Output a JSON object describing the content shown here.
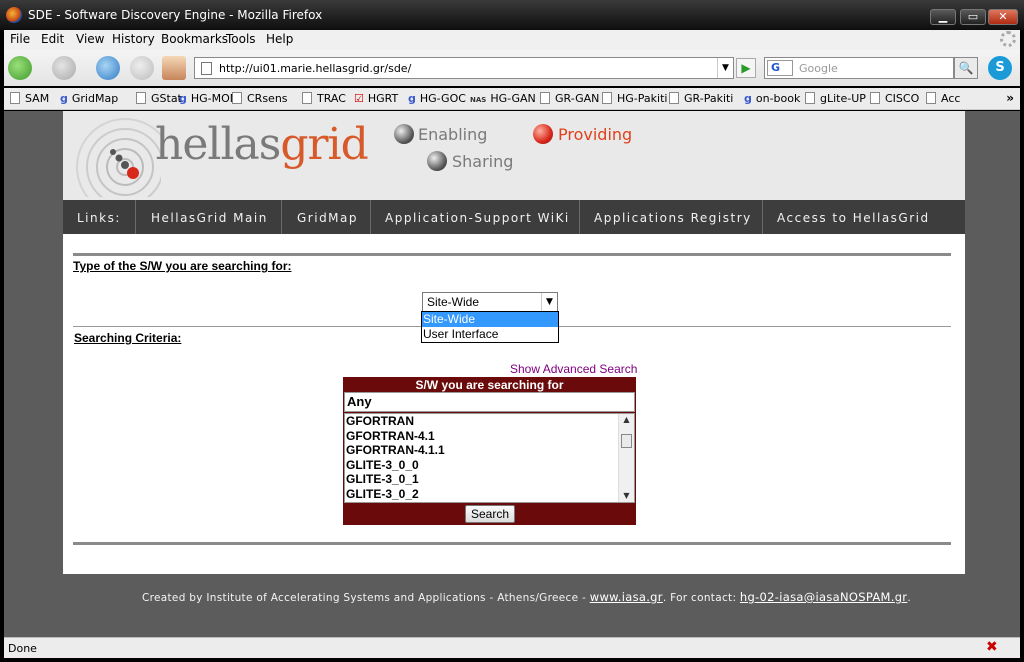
{
  "window": {
    "title": "SDE - Software Discovery Engine - Mozilla Firefox",
    "min_label": "▁",
    "max_label": "▭",
    "close_label": "✕"
  },
  "menu": [
    "File",
    "Edit",
    "View",
    "History",
    "Bookmarks",
    "Tools",
    "Help"
  ],
  "toolbar": {
    "url": "http://ui01.marie.hellasgrid.gr/sde/",
    "search_engine": "G",
    "search_placeholder": "Google",
    "go_icon": "▶",
    "search_icon": "🔍",
    "skype_label": "S"
  },
  "bookmarks": [
    {
      "label": "SAM",
      "icon": "page"
    },
    {
      "label": "GridMap",
      "icon": "g"
    },
    {
      "label": "GStat",
      "icon": "page"
    },
    {
      "label": "HG-MON",
      "icon": "g"
    },
    {
      "label": "CRsens",
      "icon": "page"
    },
    {
      "label": "TRAC",
      "icon": "page"
    },
    {
      "label": "HGRT",
      "icon": "check"
    },
    {
      "label": "HG-GOC",
      "icon": "g"
    },
    {
      "label": "HG-GAN",
      "icon": "nas"
    },
    {
      "label": "GR-GAN",
      "icon": "page"
    },
    {
      "label": "HG-Pakiti",
      "icon": "page"
    },
    {
      "label": "GR-Pakiti",
      "icon": "page"
    },
    {
      "label": "on-book",
      "icon": "g"
    },
    {
      "label": "gLite-UP",
      "icon": "page"
    },
    {
      "label": "CISCO",
      "icon": "page"
    },
    {
      "label": "Acc",
      "icon": "page"
    }
  ],
  "bookmarks_more": "»",
  "banner": {
    "logo_h": "hellas",
    "logo_g": "grid",
    "taglines": {
      "enabling": "Enabling",
      "sharing": "Sharing",
      "providing": "Providing"
    }
  },
  "nav_links": [
    "Links:",
    "HellasGrid Main",
    "GridMap",
    "Application-Support WiKi",
    "Applications Registry",
    "Access to HellasGrid"
  ],
  "form": {
    "type_label": "Type of the S/W you are searching for:",
    "type_selected": "Site-Wide",
    "type_options": [
      "Site-Wide",
      "User Interface"
    ],
    "criteria_label": "Searching Criteria:",
    "advanced_link": "Show Advanced Search",
    "sw_header": "S/W you are searching for",
    "sw_any": "Any",
    "sw_items": [
      "GFORTRAN",
      "GFORTRAN-4.1",
      "GFORTRAN-4.1.1",
      "GLITE-3_0_0",
      "GLITE-3_0_1",
      "GLITE-3_0_2"
    ],
    "search_button": "Search"
  },
  "footer": {
    "text": "Created by Institute of Accelerating Systems and Applications - Athens/Greece - ",
    "site_link": "www.iasa.gr",
    "contact_text": ". For contact: ",
    "email_link": "hg-02-iasa@iasaNOSPAM.gr",
    "end": "."
  },
  "status": "Done"
}
